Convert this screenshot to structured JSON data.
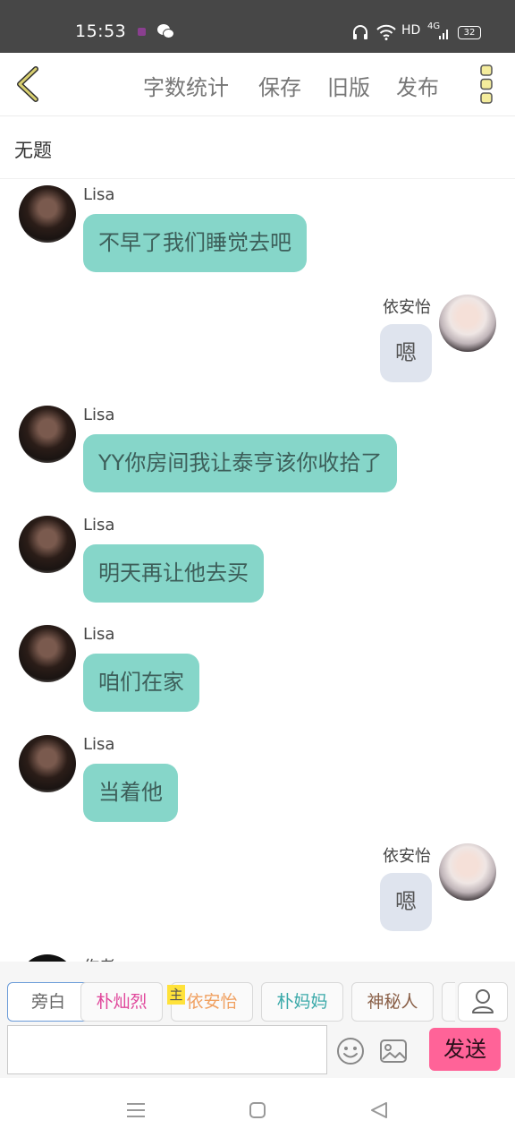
{
  "status_bar": {
    "time": "15:53",
    "network": "HD",
    "signal": "4G",
    "battery": "32"
  },
  "toolbar": {
    "word_count": "字数统计",
    "save": "保存",
    "old_version": "旧版",
    "publish": "发布"
  },
  "doc_title": "无题",
  "messages": [
    {
      "side": "left",
      "name": "Lisa",
      "text": "不早了我们睡觉去吧"
    },
    {
      "side": "right",
      "name": "依安怡",
      "text": "嗯"
    },
    {
      "side": "left",
      "name": "Lisa",
      "text": "YY你房间我让泰亨该你收拾了"
    },
    {
      "side": "left",
      "name": "Lisa",
      "text": "明天再让他去买"
    },
    {
      "side": "left",
      "name": "Lisa",
      "text": "咱们在家"
    },
    {
      "side": "left",
      "name": "Lisa",
      "text": "当着他"
    },
    {
      "side": "right",
      "name": "依安怡",
      "text": "嗯"
    },
    {
      "side": "left",
      "name": "作者",
      "text": ""
    }
  ],
  "characters": [
    {
      "label": "旁白",
      "color": "#666666"
    },
    {
      "label": "朴灿烈",
      "color": "#e0479b"
    },
    {
      "label": "依安怡",
      "color": "#f0a060",
      "badge": "主"
    },
    {
      "label": "朴妈妈",
      "color": "#3aa9a9"
    },
    {
      "label": "神秘人",
      "color": "#8a6048"
    }
  ],
  "input": {
    "value": "",
    "placeholder": ""
  },
  "send_label": "发送"
}
